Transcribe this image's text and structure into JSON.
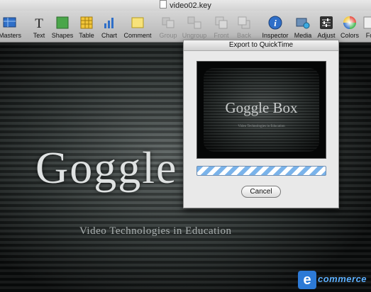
{
  "window": {
    "title": "video02.key"
  },
  "toolbar": {
    "items": [
      {
        "label": "Masters",
        "icon": "masters-icon",
        "enabled": true
      },
      {
        "label": "Text",
        "icon": "text-icon",
        "enabled": true
      },
      {
        "label": "Shapes",
        "icon": "shapes-icon",
        "enabled": true
      },
      {
        "label": "Table",
        "icon": "table-icon",
        "enabled": true
      },
      {
        "label": "Chart",
        "icon": "chart-icon",
        "enabled": true
      },
      {
        "label": "Comment",
        "icon": "comment-icon",
        "enabled": true
      },
      {
        "label": "Group",
        "icon": "group-icon",
        "enabled": false
      },
      {
        "label": "Ungroup",
        "icon": "ungroup-icon",
        "enabled": false
      },
      {
        "label": "Front",
        "icon": "front-icon",
        "enabled": false
      },
      {
        "label": "Back",
        "icon": "back-icon",
        "enabled": false
      },
      {
        "label": "Inspector",
        "icon": "inspector-icon",
        "enabled": true
      },
      {
        "label": "Media",
        "icon": "media-icon",
        "enabled": true
      },
      {
        "label": "Adjust",
        "icon": "adjust-icon",
        "enabled": true
      },
      {
        "label": "Colors",
        "icon": "colors-icon",
        "enabled": true
      },
      {
        "label": "Fo",
        "icon": "fonts-icon",
        "enabled": true
      }
    ]
  },
  "slide": {
    "title": "Goggle",
    "subtitle": "Video Technologies in Education"
  },
  "export_dialog": {
    "title": "Export to QuickTime",
    "preview_title": "Goggle Box",
    "preview_subtitle": "Video Technologies in Education",
    "progress": "indeterminate",
    "cancel_label": "Cancel"
  },
  "logo": {
    "letter": "e",
    "word": "commerce"
  },
  "colors": {
    "accent": "#2d7ad6",
    "progress_stripe": "#7ab3ea",
    "logo_text": "#5cb0ff"
  }
}
